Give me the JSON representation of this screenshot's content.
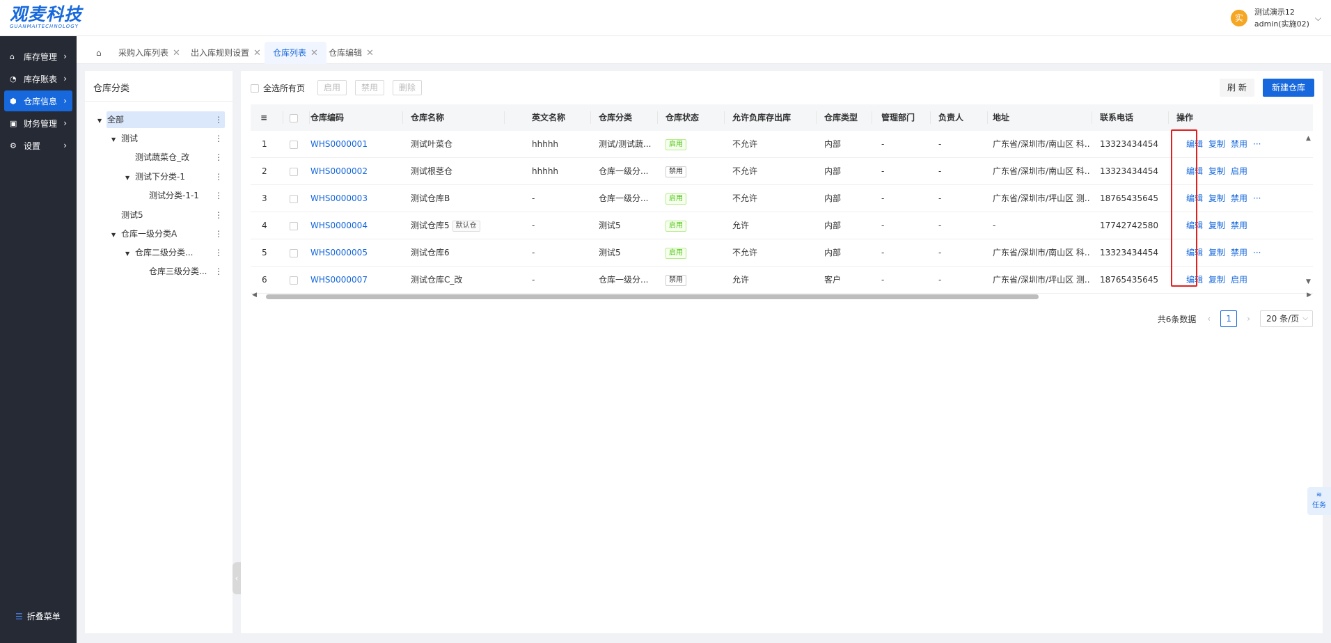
{
  "app": {
    "logo": "观麦科技",
    "logo_sub": "GUANMAITECHNOLOGY"
  },
  "user": {
    "avatar": "实",
    "name": "测试演示12",
    "role": "admin(实施02)"
  },
  "sidebar": {
    "items": [
      {
        "label": "库存管理",
        "icon": "home-icon"
      },
      {
        "label": "库存账表",
        "icon": "chart-icon"
      },
      {
        "label": "仓库信息",
        "icon": "warehouse-icon",
        "active": true
      },
      {
        "label": "财务管理",
        "icon": "finance-icon"
      },
      {
        "label": "设置",
        "icon": "gear-icon"
      }
    ],
    "collapse": "折叠菜单"
  },
  "tabs": [
    {
      "label": "采购入库列表"
    },
    {
      "label": "出入库规则设置"
    },
    {
      "label": "仓库列表",
      "active": true
    },
    {
      "label": "仓库编辑"
    }
  ],
  "category": {
    "title": "仓库分类",
    "items": [
      {
        "label": "全部"
      },
      {
        "label": "测试"
      },
      {
        "label": "测试蔬菜仓_改"
      },
      {
        "label": "测试下分类-1"
      },
      {
        "label": "测试分类-1-1"
      },
      {
        "label": "测试5"
      },
      {
        "label": "仓库一级分类A"
      },
      {
        "label": "仓库二级分类..."
      },
      {
        "label": "仓库三级分类..."
      }
    ]
  },
  "toolbar": {
    "select_all": "全选所有页",
    "enable": "启用",
    "disable": "禁用",
    "delete": "删除",
    "refresh": "刷 新",
    "new_warehouse": "新建仓库"
  },
  "table": {
    "columns": [
      "仓库编码",
      "仓库名称",
      "英文名称",
      "仓库分类",
      "仓库状态",
      "允许负库存出库",
      "仓库类型",
      "管理部门",
      "负责人",
      "地址",
      "联系电话",
      "操作"
    ],
    "rows": [
      {
        "idx": "1",
        "code": "WHS0000001",
        "name": "测试叶菜仓",
        "en": "hhhhh",
        "cat": "测试/测试蔬...",
        "status": "启用",
        "neg": "不允许",
        "type": "内部",
        "dept": "-",
        "owner": "-",
        "addr": "广东省/深圳市/南山区 科...",
        "phone": "13323434454",
        "act1": "编辑",
        "act2": "复制",
        "act3": "禁用",
        "more": "···"
      },
      {
        "idx": "2",
        "code": "WHS0000002",
        "name": "测试根茎仓",
        "en": "hhhhh",
        "cat": "仓库一级分...",
        "status": "禁用",
        "neg": "不允许",
        "type": "内部",
        "dept": "-",
        "owner": "-",
        "addr": "广东省/深圳市/南山区 科...",
        "phone": "13323434454",
        "act1": "编辑",
        "act2": "复制",
        "act3": "启用",
        "more": ""
      },
      {
        "idx": "3",
        "code": "WHS0000003",
        "name": "测试仓库B",
        "en": "-",
        "cat": "仓库一级分...",
        "status": "启用",
        "neg": "不允许",
        "type": "内部",
        "dept": "-",
        "owner": "-",
        "addr": "广东省/深圳市/坪山区 测...",
        "phone": "18765435645",
        "act1": "编辑",
        "act2": "复制",
        "act3": "禁用",
        "more": "···"
      },
      {
        "idx": "4",
        "code": "WHS0000004",
        "name": "测试仓库5",
        "default": "默认仓",
        "en": "-",
        "cat": "测试5",
        "status": "启用",
        "neg": "允许",
        "type": "内部",
        "dept": "-",
        "owner": "-",
        "addr": "-",
        "phone": "17742742580",
        "act1": "编辑",
        "act2": "复制",
        "act3": "禁用",
        "more": ""
      },
      {
        "idx": "5",
        "code": "WHS0000005",
        "name": "测试仓库6",
        "en": "-",
        "cat": "测试5",
        "status": "启用",
        "neg": "不允许",
        "type": "内部",
        "dept": "-",
        "owner": "-",
        "addr": "广东省/深圳市/南山区 科...",
        "phone": "13323434454",
        "act1": "编辑",
        "act2": "复制",
        "act3": "禁用",
        "more": "···"
      },
      {
        "idx": "6",
        "code": "WHS0000007",
        "name": "测试仓库C_改",
        "en": "-",
        "cat": "仓库一级分...",
        "status": "禁用",
        "neg": "允许",
        "type": "客户",
        "dept": "-",
        "owner": "-",
        "addr": "广东省/深圳市/坪山区 测...",
        "phone": "18765435645",
        "act1": "编辑",
        "act2": "复制",
        "act3": "启用",
        "more": ""
      }
    ]
  },
  "pager": {
    "total": "共6条数据",
    "page": "1",
    "size": "20 条/页"
  },
  "task": {
    "label": "任务"
  }
}
